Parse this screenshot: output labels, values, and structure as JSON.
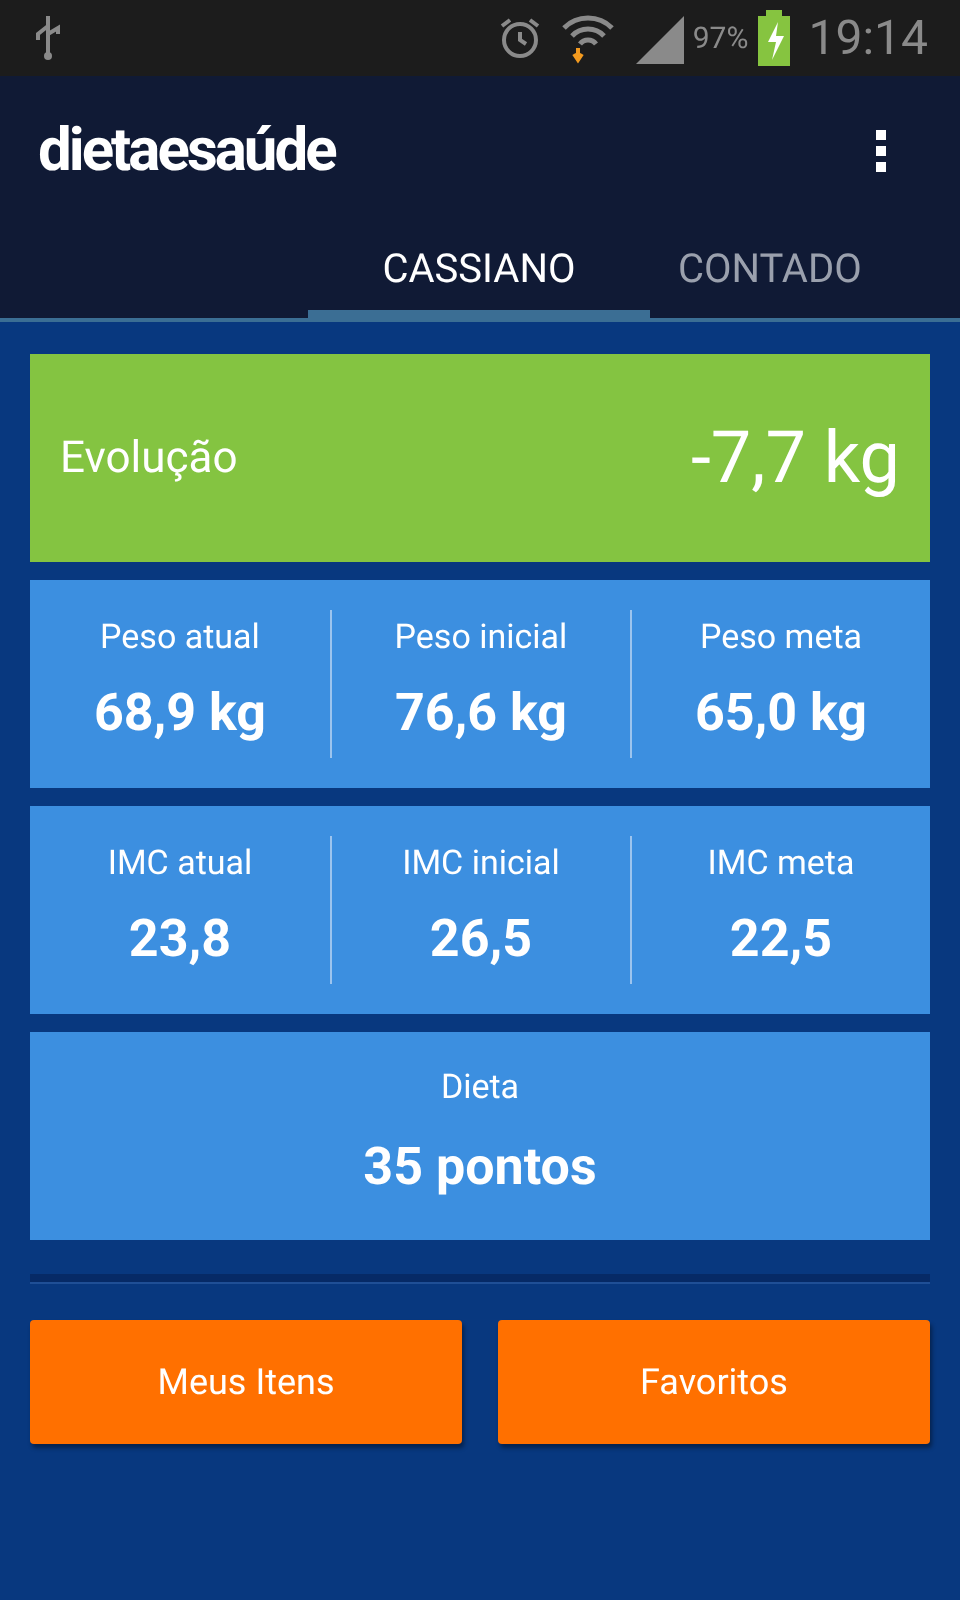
{
  "status_bar": {
    "battery": "97%",
    "time": "19:14"
  },
  "app_bar": {
    "logo": "dietaesaúde"
  },
  "tabs": [
    {
      "label": "CASSIANO",
      "selected": true
    },
    {
      "label": "CONTADO",
      "selected": false
    }
  ],
  "evolution": {
    "label": "Evolução",
    "value": "-7,7 kg"
  },
  "stat_groups": [
    {
      "stats": [
        {
          "label": "Peso atual",
          "value": "68,9 kg"
        },
        {
          "label": "Peso inicial",
          "value": "76,6 kg"
        },
        {
          "label": "Peso meta",
          "value": "65,0 kg"
        }
      ]
    },
    {
      "stats": [
        {
          "label": "IMC atual",
          "value": "23,8"
        },
        {
          "label": "IMC inicial",
          "value": "26,5"
        },
        {
          "label": "IMC meta",
          "value": "22,5"
        }
      ]
    }
  ],
  "diet": {
    "label": "Dieta",
    "value": "35 pontos"
  },
  "buttons": [
    "Meus Itens",
    "Favoritos"
  ]
}
